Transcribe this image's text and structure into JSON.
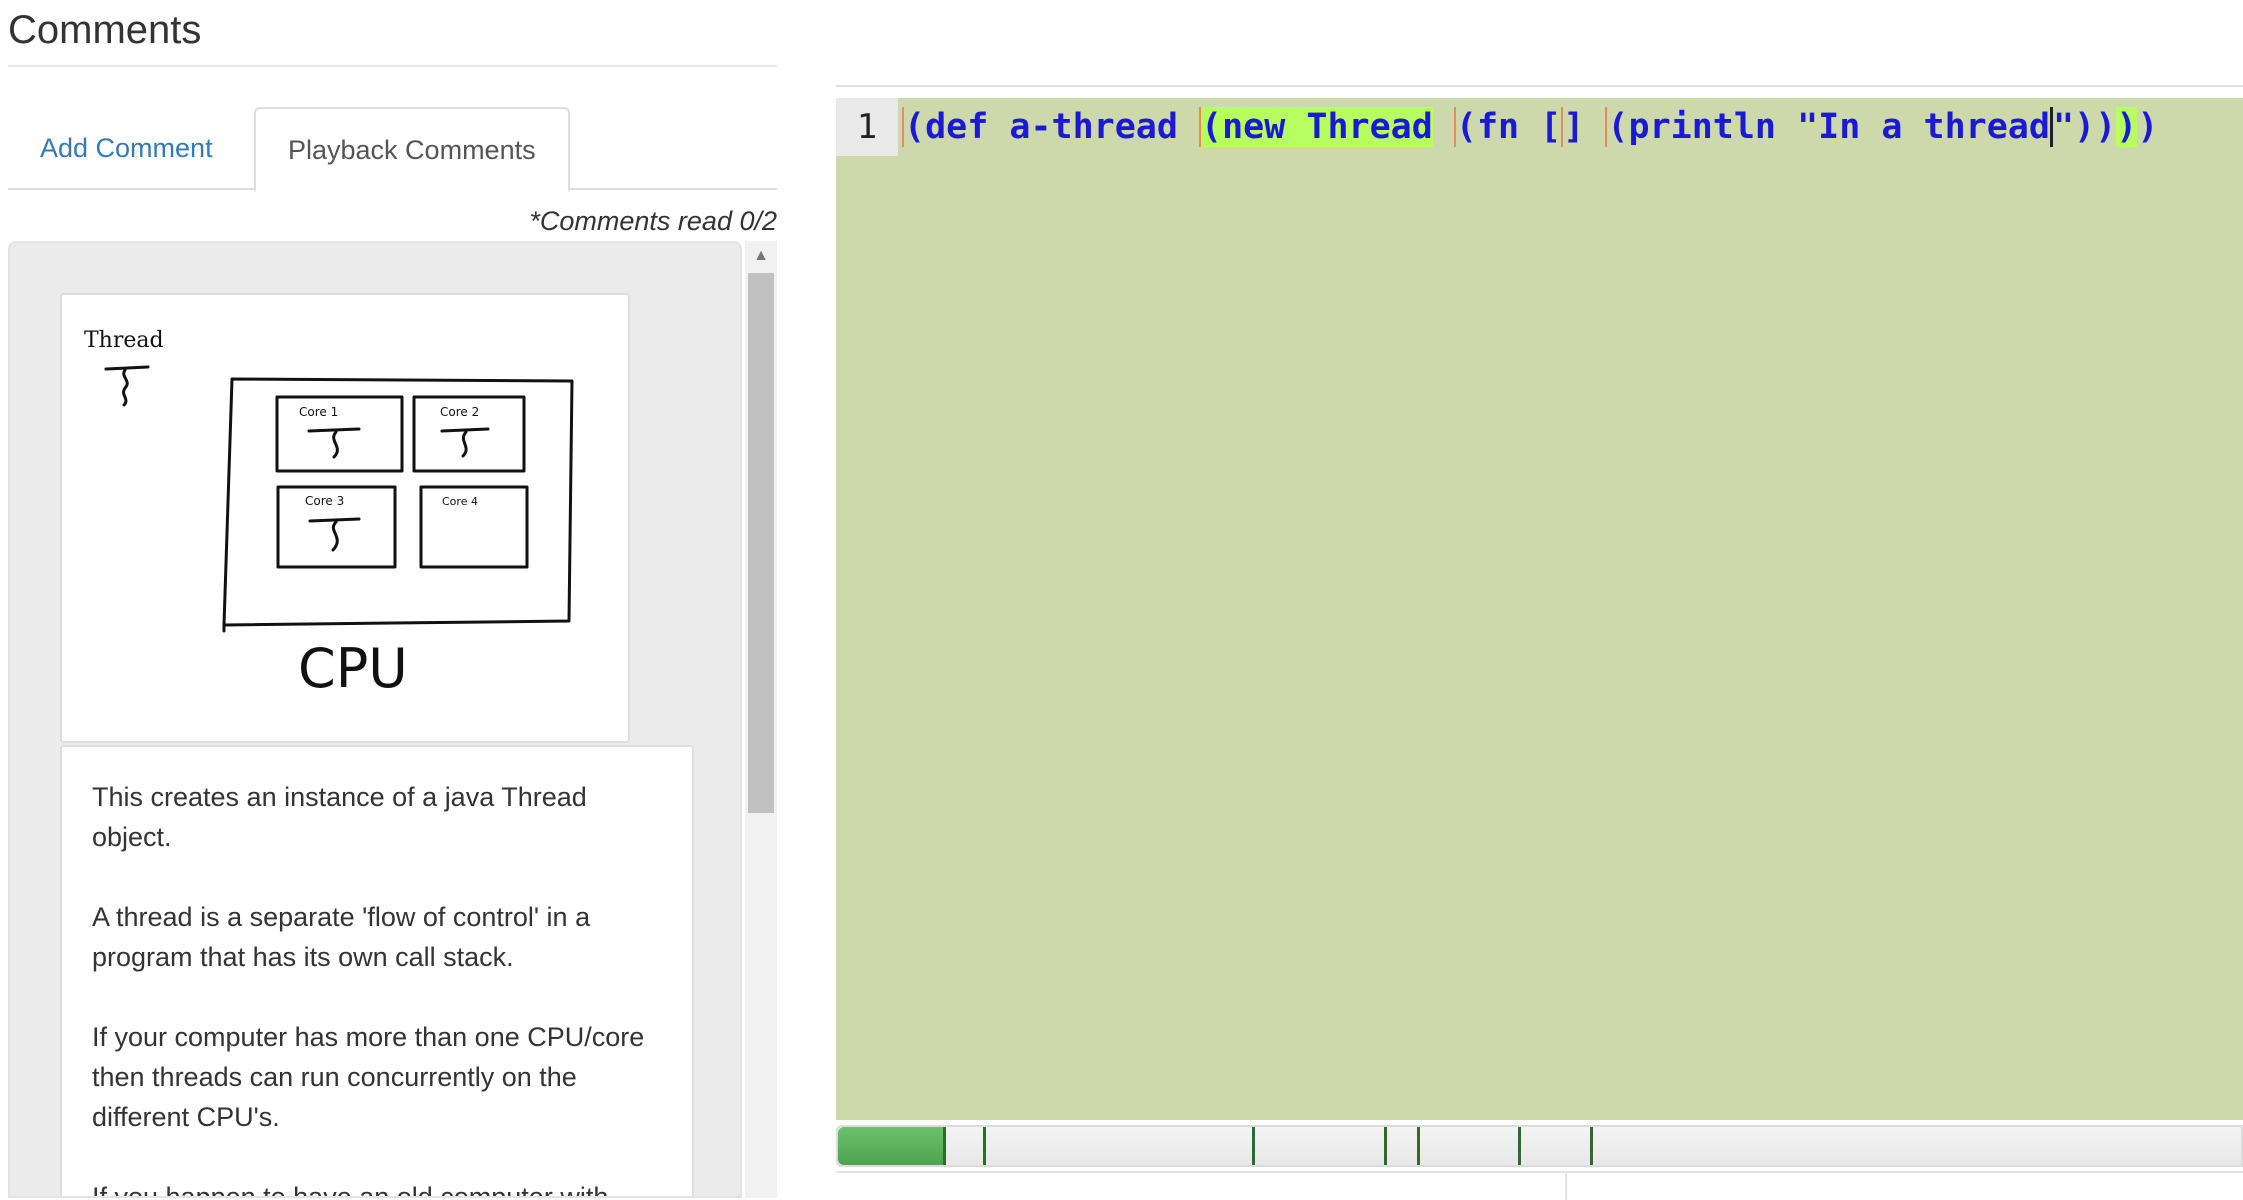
{
  "comments": {
    "title": "Comments",
    "tabs": [
      {
        "label": "Add Comment",
        "active": false
      },
      {
        "label": "Playback Comments",
        "active": true
      }
    ],
    "read_status": "*Comments read 0/2",
    "image": {
      "thread_label": "Thread",
      "cores": [
        "Core 1",
        "Core 2",
        "Core 3",
        "Core 4"
      ],
      "cpu_label": "CPU"
    },
    "paragraphs": [
      "This creates an instance of a java Thread object.",
      "A thread is a separate 'flow of control' in a program that has its own call stack.",
      "If your computer has more than one CPU/core then threads can run concurrently on the different CPU's.",
      "If you happen to have an old computer with"
    ]
  },
  "editor": {
    "line_number": "1",
    "code_segments": [
      "(",
      "def a-thread ",
      "(",
      "new Thread",
      " ",
      "(",
      "fn [",
      "]",
      " ",
      "(",
      "println \"",
      "In a thread",
      "\"))",
      ")",
      ")"
    ]
  },
  "timeline": {
    "progress_fraction": 0.077,
    "tick_fractions": [
      0.103,
      0.295,
      0.389,
      0.413,
      0.485,
      0.536
    ]
  },
  "colors": {
    "editor_bg": "#cdd9aa",
    "highlight": "#b6ff5f",
    "code_text": "#1a1ad6",
    "link_blue": "#337ab7",
    "timeline_fill": "#4fa24f"
  }
}
